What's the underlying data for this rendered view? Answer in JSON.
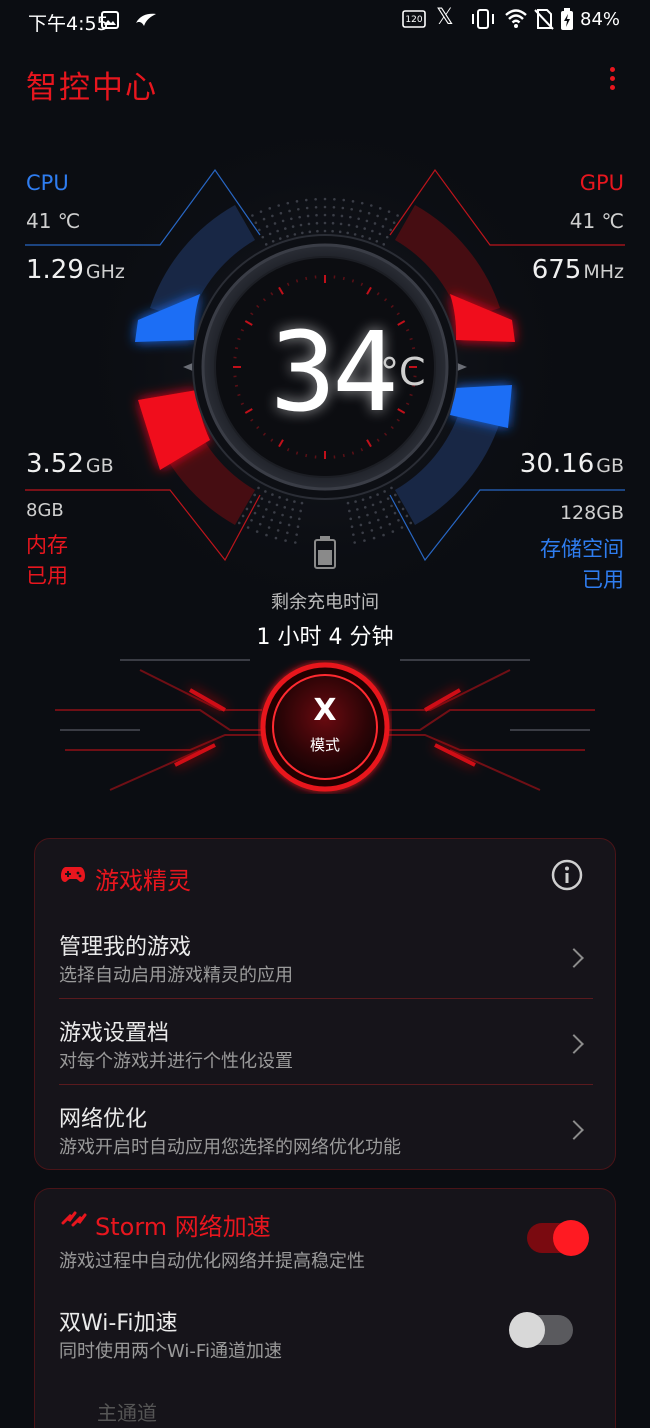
{
  "status_bar": {
    "time": "下午4:55",
    "battery_percent": "84%",
    "icons": [
      "gallery-icon",
      "rog-icon",
      "120hz-icon",
      "x-mode-icon",
      "vibrate-icon",
      "wifi-icon",
      "no-sim-icon",
      "battery-charging-icon"
    ],
    "refresh_rate_label": "120",
    "x_glyph": "𝕏"
  },
  "header": {
    "title": "智控中心"
  },
  "gauge": {
    "cpu": {
      "label": "CPU",
      "temp": "41 ℃",
      "freq_value": "1.29",
      "freq_unit": "GHz"
    },
    "gpu": {
      "label": "GPU",
      "temp": "41 ℃",
      "freq_value": "675",
      "freq_unit": "MHz"
    },
    "memory": {
      "used_value": "3.52",
      "used_unit": "GB",
      "total": "8GB",
      "label_line1": "内存",
      "label_line2": "已用"
    },
    "storage": {
      "used_value": "30.16",
      "used_unit": "GB",
      "total": "128GB",
      "label_line1": "存储空间",
      "label_line2": "已用"
    },
    "temperature": {
      "value": "34",
      "unit": "°C"
    },
    "charge": {
      "label": "剩余充电时间",
      "value": "1 小时 4 分钟"
    },
    "x_mode": {
      "icon_glyph": "X",
      "label": "模式"
    }
  },
  "game_genie": {
    "title": "游戏精灵",
    "items": [
      {
        "title": "管理我的游戏",
        "subtitle": "选择自动启用游戏精灵的应用"
      },
      {
        "title": "游戏设置档",
        "subtitle": "对每个游戏并进行个性化设置"
      },
      {
        "title": "网络优化",
        "subtitle": "游戏开启时自动应用您选择的网络优化功能"
      }
    ]
  },
  "storm": {
    "title": "Storm 网络加速",
    "subtitle": "游戏过程中自动优化网络并提高稳定性",
    "enabled": true,
    "dual_wifi": {
      "title": "双Wi-Fi加速",
      "subtitle": "同时使用两个Wi-Fi通道加速",
      "enabled": false
    },
    "main_channel_label": "主通道"
  },
  "colors": {
    "accent_red": "#e8161e",
    "accent_blue": "#2f7df0",
    "background": "#0b0d12"
  }
}
